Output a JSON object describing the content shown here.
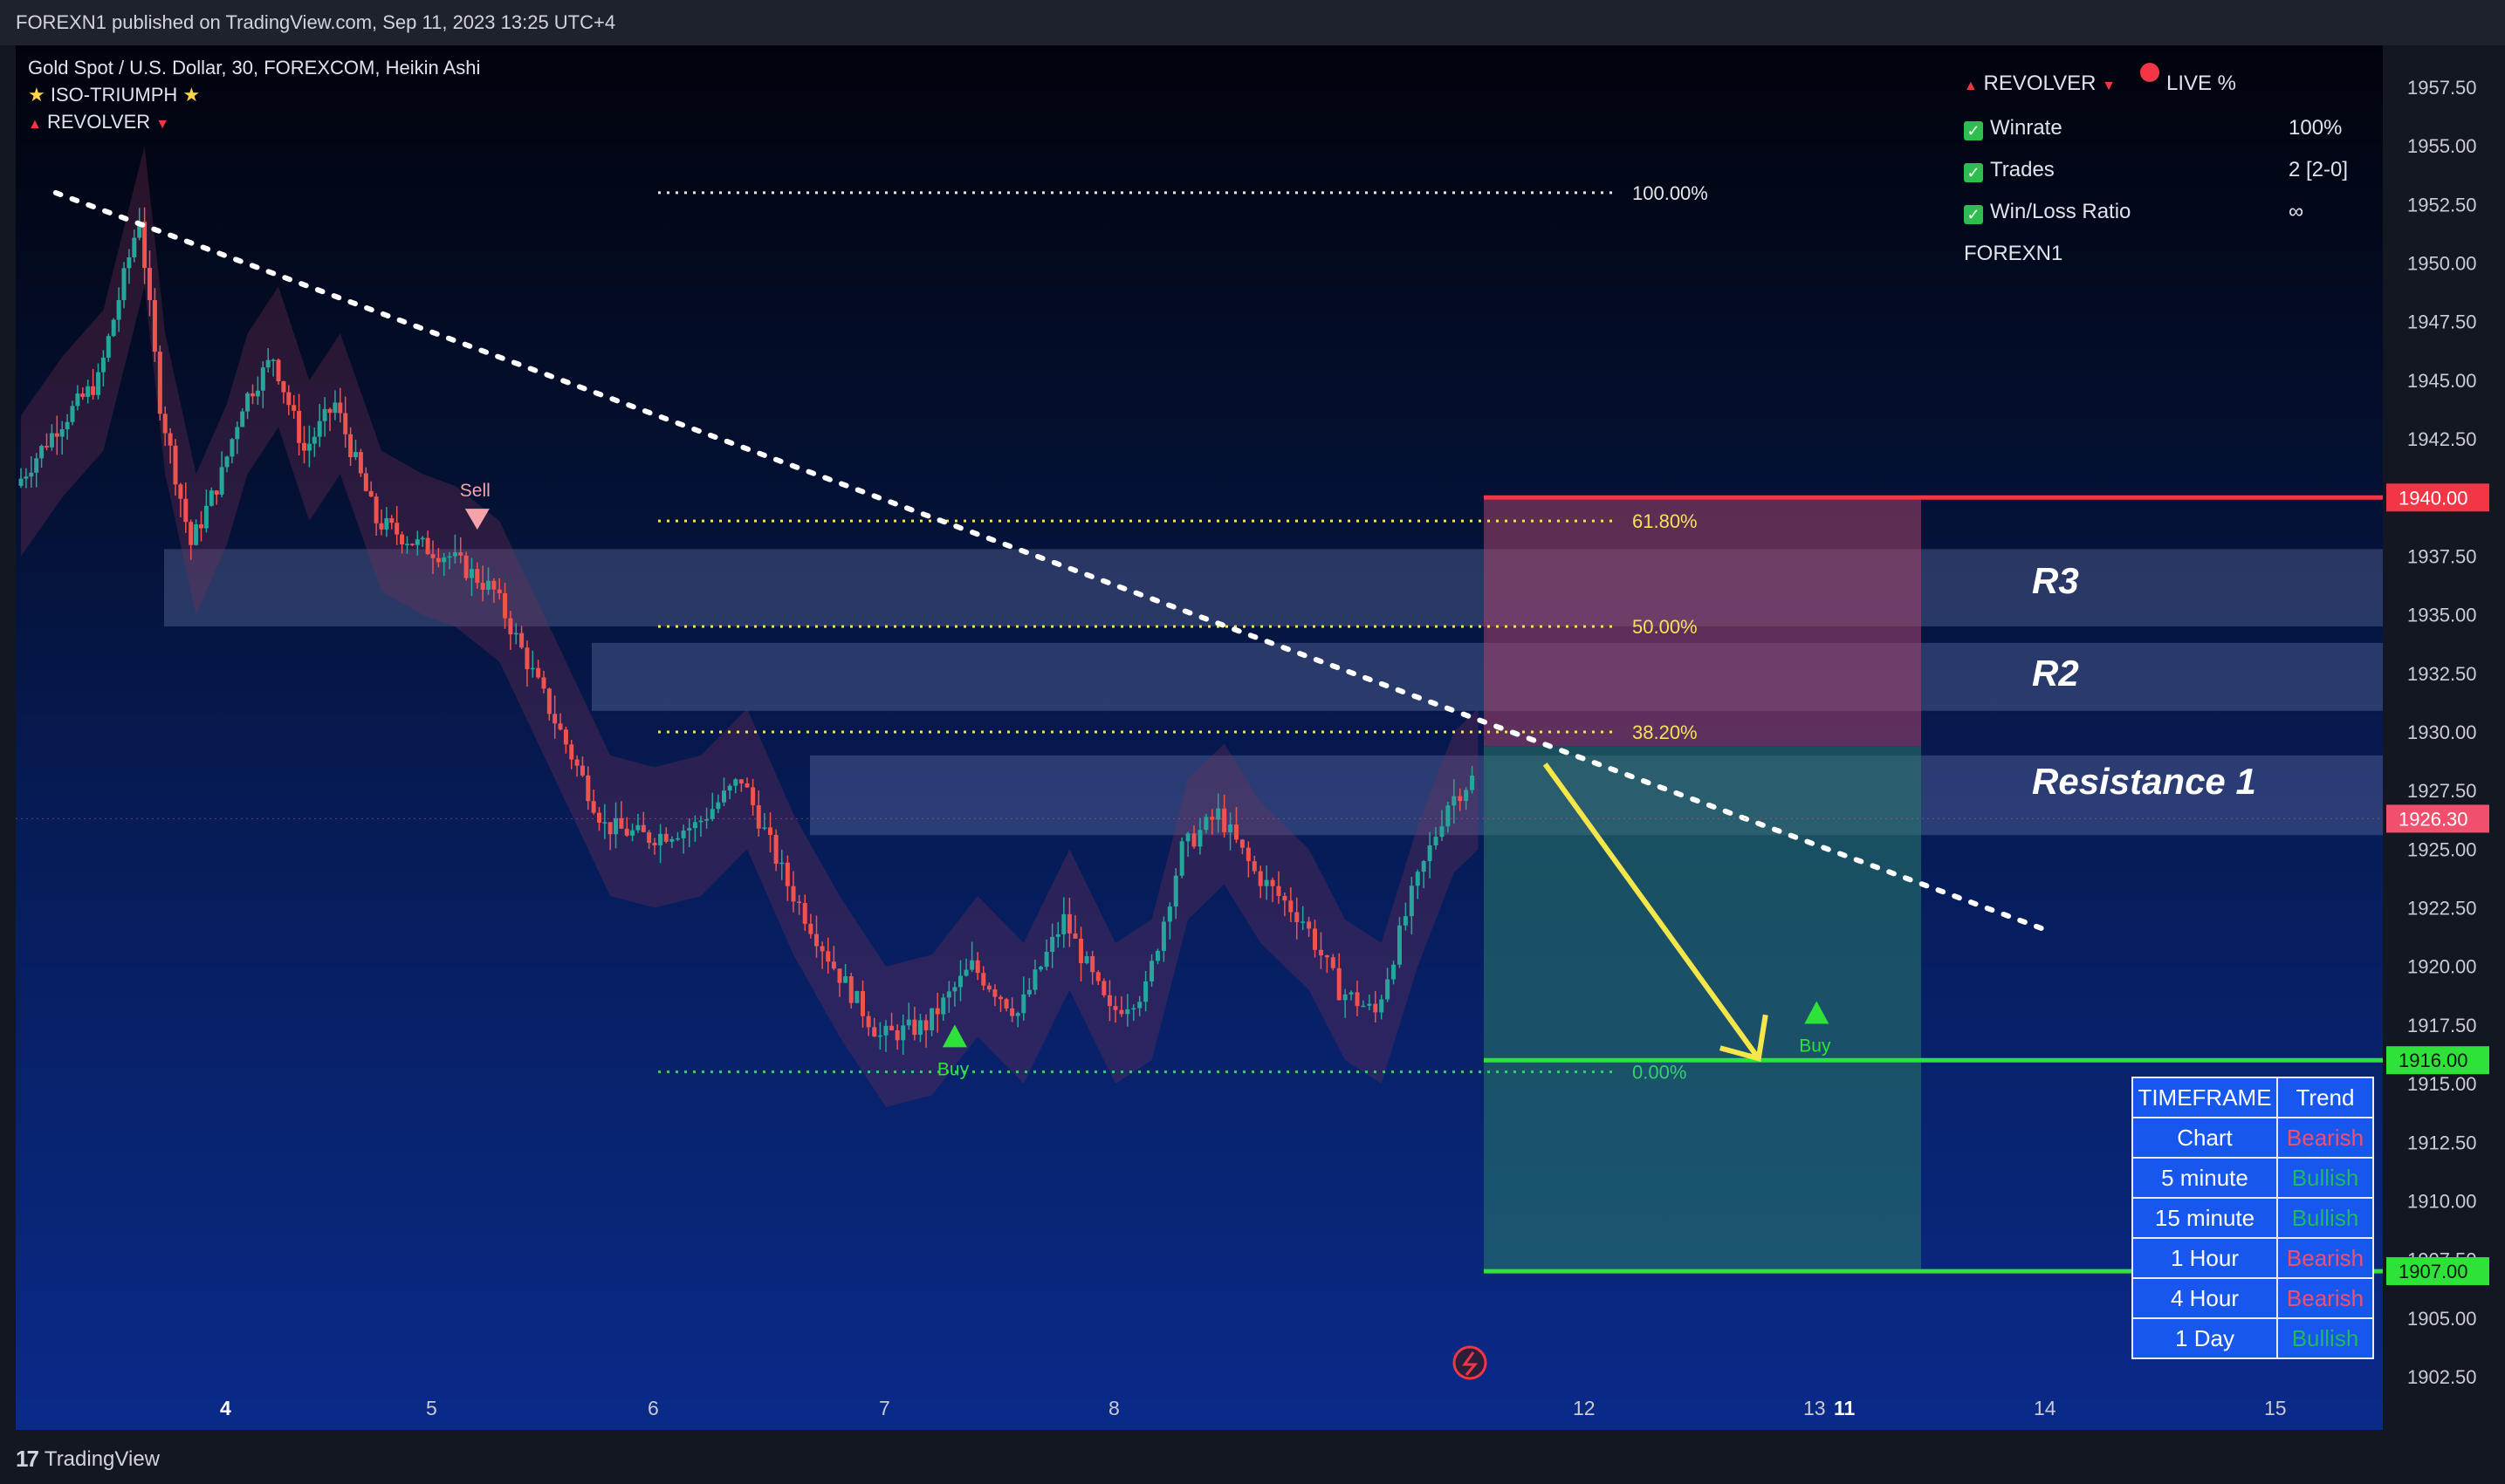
{
  "header": {
    "publish_text": "FOREXN1 published on TradingView.com, Sep 11, 2023 13:25 UTC+4"
  },
  "legend": {
    "symbol": "Gold Spot / U.S. Dollar, 30, FOREXCOM, Heikin Ashi",
    "indicator1": "ISO-TRIUMPH",
    "indicator2": "REVOLVER"
  },
  "stats": {
    "title": "REVOLVER",
    "live": "LIVE %",
    "winrate_label": "Winrate",
    "winrate_value": "100%",
    "trades_label": "Trades",
    "trades_value": "2 [2-0]",
    "wl_label": "Win/Loss Ratio",
    "wl_value": "∞",
    "author": "FOREXN1"
  },
  "fib": {
    "l100": "100.00%",
    "l618": "61.80%",
    "l50": "50.00%",
    "l382": "38.20%",
    "l0": "0.00%"
  },
  "zones": {
    "r3": "R3",
    "r2": "R2",
    "r1": "Resistance 1"
  },
  "signals": {
    "sell": "Sell",
    "buy": "Buy"
  },
  "timeframe_table": {
    "header_tf": "TIMEFRAME",
    "header_trend": "Trend",
    "rows": [
      {
        "tf": "Chart",
        "trend": "Bearish"
      },
      {
        "tf": "5 minute",
        "trend": "Bullish"
      },
      {
        "tf": "15 minute",
        "trend": "Bullish"
      },
      {
        "tf": "1 Hour",
        "trend": "Bearish"
      },
      {
        "tf": "4 Hour",
        "trend": "Bearish"
      },
      {
        "tf": "1 Day",
        "trend": "Bullish"
      }
    ]
  },
  "footer": {
    "brand": "TradingView"
  },
  "colors": {
    "bull": "#26a69a",
    "bear": "#ef5350",
    "tp": "#2ee23a",
    "sl": "#f23645",
    "fib": "#f5e15a",
    "trend": "#ffffff",
    "arrow": "#f5e64a",
    "table": "#1757ee"
  },
  "chart_data": {
    "type": "candlestick",
    "symbol": "XAUUSD",
    "interval": "30",
    "ylim": [
      1900.5,
      1960
    ],
    "y_ticks": [
      1957.5,
      1955,
      1952.5,
      1950,
      1947.5,
      1945,
      1942.5,
      1940,
      1937.5,
      1935,
      1932.5,
      1930,
      1927.5,
      1925,
      1922.5,
      1920,
      1917.5,
      1915,
      1912.5,
      1910,
      1907.5,
      1905,
      1902.5
    ],
    "x_tick_labels": [
      "4",
      "5",
      "6",
      "7",
      "8",
      "11",
      "12",
      "13",
      "14",
      "15"
    ],
    "x_tick_bold": [
      "4",
      "11"
    ],
    "price_path": [
      [
        3.0,
        1940.5
      ],
      [
        3.2,
        1943
      ],
      [
        3.4,
        1945
      ],
      [
        3.6,
        1952
      ],
      [
        3.7,
        1944
      ],
      [
        3.85,
        1938
      ],
      [
        4.0,
        1941
      ],
      [
        4.1,
        1944
      ],
      [
        4.25,
        1946
      ],
      [
        4.4,
        1942
      ],
      [
        4.55,
        1944
      ],
      [
        4.75,
        1939
      ],
      [
        4.95,
        1938
      ],
      [
        5.1,
        1937.5
      ],
      [
        5.3,
        1936
      ],
      [
        5.5,
        1932
      ],
      [
        5.65,
        1929
      ],
      [
        5.8,
        1926
      ],
      [
        6.0,
        1925.5
      ],
      [
        6.2,
        1926
      ],
      [
        6.4,
        1928
      ],
      [
        6.6,
        1923.5
      ],
      [
        6.8,
        1920
      ],
      [
        7.0,
        1917
      ],
      [
        7.2,
        1917.5
      ],
      [
        7.4,
        1920
      ],
      [
        7.6,
        1918
      ],
      [
        7.8,
        1922
      ],
      [
        8.0,
        1918
      ],
      [
        8.15,
        1919
      ],
      [
        8.3,
        1925
      ],
      [
        8.45,
        1926.5
      ],
      [
        8.6,
        1924
      ],
      [
        8.8,
        1922
      ],
      [
        8.95,
        1919
      ],
      [
        9.1,
        1918
      ],
      [
        9.25,
        1923
      ],
      [
        9.4,
        1927
      ],
      [
        9.5,
        1928
      ]
    ],
    "levels": {
      "sl": 1940.0,
      "last": 1926.3,
      "tp1": 1916.0,
      "tp2": 1907.0
    },
    "level_labels": {
      "sl": "1940.00",
      "last": "1926.30",
      "tp1": "1916.00",
      "tp2": "1907.00"
    },
    "fib_levels": [
      {
        "pct": "100.00%",
        "price": 1953.0
      },
      {
        "pct": "61.80%",
        "price": 1939.0
      },
      {
        "pct": "50.00%",
        "price": 1934.5
      },
      {
        "pct": "38.20%",
        "price": 1930.0
      },
      {
        "pct": "0.00%",
        "price": 1915.5
      }
    ],
    "zones": [
      {
        "name": "R3",
        "top": 1937.8,
        "bottom": 1934.5
      },
      {
        "name": "R2",
        "top": 1933.8,
        "bottom": 1930.9
      },
      {
        "name": "Resistance 1",
        "top": 1929.0,
        "bottom": 1925.6
      }
    ],
    "trendline": [
      [
        3.55,
        1953.0
      ],
      [
        14.0,
        1921.5
      ]
    ],
    "projection_arrow": [
      [
        11.75,
        1929.0
      ],
      [
        12.7,
        1916.0
      ]
    ],
    "signals": [
      {
        "type": "sell",
        "x": 5.2,
        "price": 1939.0
      },
      {
        "type": "buy",
        "x": 7.3,
        "price": 1917.0
      },
      {
        "type": "buy",
        "x": 10.9,
        "price": 1918.0
      }
    ]
  }
}
